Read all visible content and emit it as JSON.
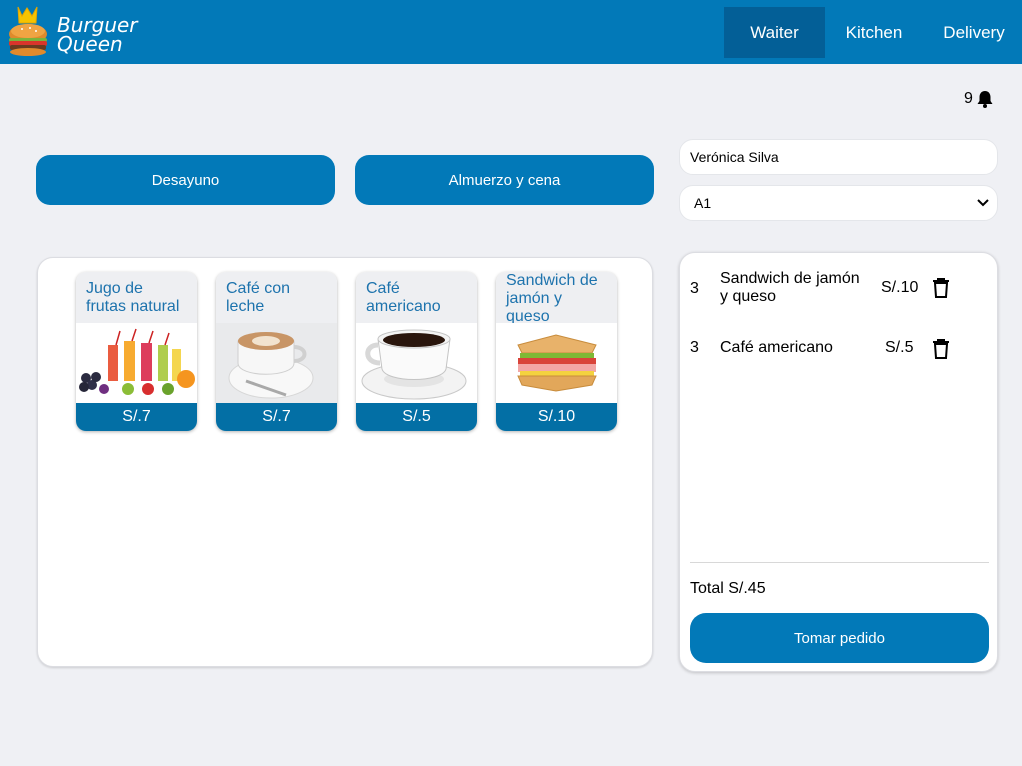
{
  "header": {
    "brand_line1": "Burguer",
    "brand_line2": "Queen",
    "nav": [
      "Waiter",
      "Kitchen",
      "Delivery"
    ],
    "active_nav": "Waiter"
  },
  "notifications": {
    "count": "9",
    "icon": "bell-icon"
  },
  "categories": [
    "Desayuno",
    "Almuerzo y cena"
  ],
  "client": {
    "name": "Verónica Silva",
    "table": "A1"
  },
  "products": [
    {
      "name": "Jugo de frutas natural",
      "price": "S/.7",
      "image": "fruit-juices-image"
    },
    {
      "name": "Café con leche",
      "price": "S/.7",
      "image": "latte-cup-image"
    },
    {
      "name": "Café americano",
      "price": "S/.5",
      "image": "coffee-cup-image"
    },
    {
      "name": "Sandwich de jamón y queso",
      "price": "S/.10",
      "image": "sandwich-image"
    }
  ],
  "order": {
    "items": [
      {
        "qty": "3",
        "name": "Sandwich de jamón y queso",
        "price": "S/.10"
      },
      {
        "qty": "3",
        "name": "Café americano",
        "price": "S/.5"
      }
    ],
    "total": "Total S/.45",
    "submit_label": "Tomar pedido"
  },
  "colors": {
    "primary": "#0279b8",
    "active_nav": "#035f97",
    "price_bar": "#036fa5",
    "card_title": "#1d73ad",
    "background": "#eff0f4"
  }
}
